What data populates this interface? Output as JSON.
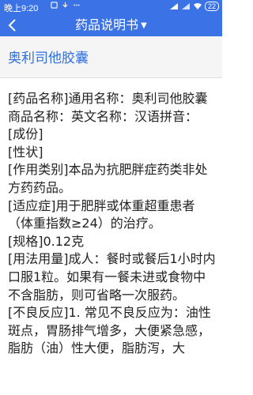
{
  "status_bar": {
    "time": "晚上9:20",
    "battery": "22"
  },
  "app_bar": {
    "title": "药品说明书"
  },
  "header": {
    "drug_name": "奥利司他胶囊"
  },
  "content": {
    "paragraphs": [
      "[药品名称]通用名称：奥利司他胶囊商品名称：英文名称：汉语拼音：",
      "[成份]",
      "[性状]",
      "[作用类别]本品为抗肥胖症药类非处方药药品。",
      "[适应症]用于肥胖或体重超重患者（体重指数≥24）的治疗。",
      "[规格]0.12克",
      "[用法用量]成人：餐时或餐后1小时内口服1粒。如果有一餐未进或食物中不含脂肪，则可省略一次服药。",
      "[不良反应]1. 常见不良反应为：油性斑点，胃肠排气增多，大便紧急感，脂肪（油）性大便，脂肪泻，大"
    ]
  },
  "colors": {
    "primary": "#3b73e6",
    "link": "#2f6fe2",
    "header_bg": "#f5f5f5"
  }
}
